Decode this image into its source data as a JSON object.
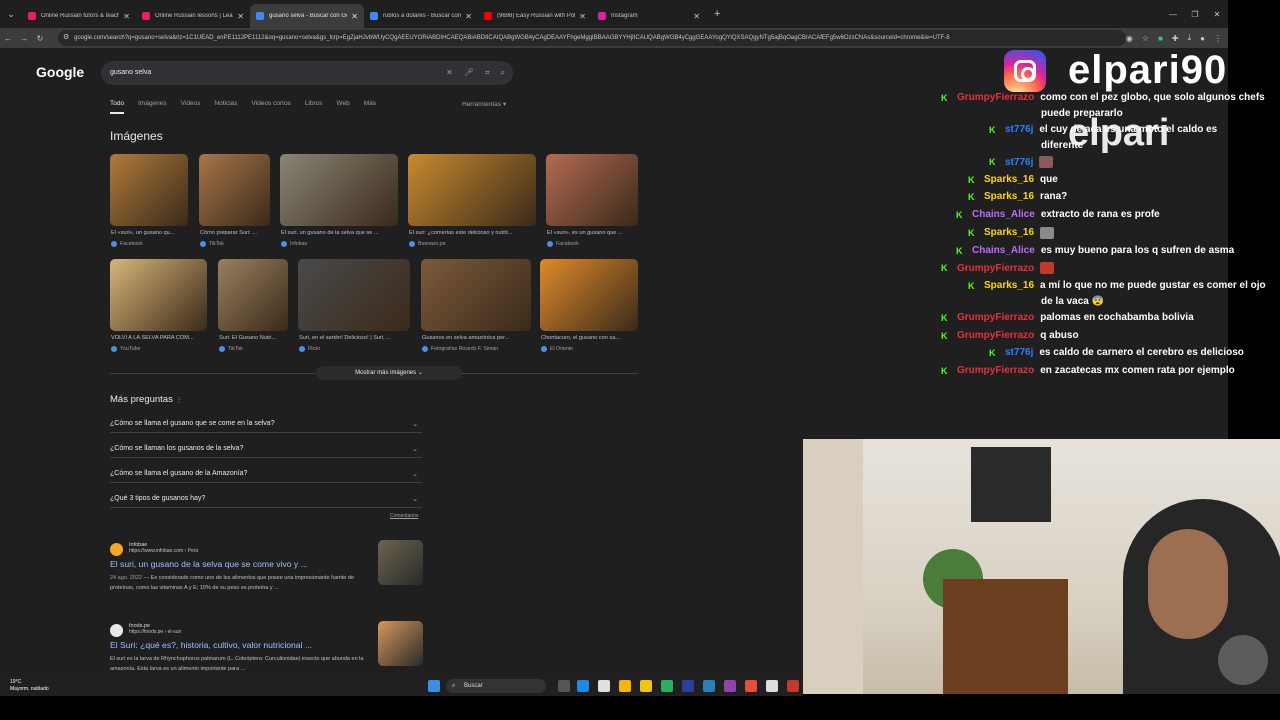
{
  "browser": {
    "tabs": [
      {
        "title": "Online Russian tutors & teache",
        "color": "#e91e63",
        "active": false
      },
      {
        "title": "Online Russian lessons | Learn",
        "color": "#e91e63",
        "active": false
      },
      {
        "title": "gusano selva - Buscar con Goo",
        "color": "#4285f4",
        "active": true
      },
      {
        "title": "rublos a dolares - Buscar con G",
        "color": "#4285f4",
        "active": false
      },
      {
        "title": "(9698) Easy Russian with Polina",
        "color": "#ff0000",
        "active": false
      },
      {
        "title": "Instagram",
        "color": "#d6249f",
        "active": false
      }
    ],
    "url": "google.com/search?q=gusano+selva&rlz=1C1UEAD_enPE1112PE1112&oq=gusano+selva&gs_lcrp=EgZjaHJvbWUyCQgAEEUYORiABDIHCAEQABiABDIICAIQABgWGB4yCAgDEAAYFhgeMggIBBAAGBYYHjIICAUQABgWGB4yCggGEAAYogQYiQXSAQgyNTg5ajBqOagCBrACAfEFg5w6OzsCNAs&sourceid=chrome&ie=UTF-8"
  },
  "google": {
    "logo": "Google",
    "query": "gusano selva",
    "filters": [
      "Todo",
      "Imágenes",
      "Videos",
      "Noticias",
      "Videos cortos",
      "Libros",
      "Web",
      "Más"
    ],
    "tools": "Herramientas",
    "images_title": "Imágenes",
    "images_row1": [
      {
        "caption": "El «suri», un gusano qu...",
        "source": "Facebook",
        "color": "#b07a3b"
      },
      {
        "caption": "Cómo preparar Suri: ...",
        "source": "TikTok",
        "color": "#a8754a"
      },
      {
        "caption": "El suri, un gusano de la selva que se ...",
        "source": "Infobae",
        "color": "#8a8575"
      },
      {
        "caption": "El suri: ¿comerías este delicioso y nutrit...",
        "source": "Buenazo.pe",
        "color": "#c98a2e"
      },
      {
        "caption": "El «suri», es un gusano que ...",
        "source": "Facebook",
        "color": "#b56a52"
      }
    ],
    "images_row2": [
      {
        "caption": "VOLVÍ A LA SELVA PARA COM...",
        "source": "YouTube",
        "color": "#d8b57a"
      },
      {
        "caption": "Suri: El Gusano Nutri...",
        "source": "TikTok",
        "color": "#9a8060"
      },
      {
        "caption": "Suri, en el sartén! Delicioso! | Suri, ...",
        "source": "Flickr",
        "color": "#4a4a4a"
      },
      {
        "caption": "Gusanos en selva amazónica per...",
        "source": "Fotografías Ricardo F. Simán",
        "color": "#7b5a3a"
      },
      {
        "caption": "Chontacuro, el gusano con sa...",
        "source": "El Oriente",
        "color": "#e08a2a"
      }
    ],
    "more_button": "Mostrar más imágenes",
    "paa_title": "Más preguntas",
    "questions": [
      "¿Cómo se llama el gusano que se come en la selva?",
      "¿Cómo se llaman los gusanos de la selva?",
      "¿Cómo se llama el gusano de la Amazonía?",
      "¿Qué 3 tipos de gusanos hay?"
    ],
    "comments_link": "Comentarios",
    "results": [
      {
        "site": "Infobae",
        "url": "https://www.infobae.com › Perú",
        "title": "El suri, un gusano de la selva que se come vivo y ...",
        "date": "24 ago. 2022 —",
        "snippet": "Es considerado como uno de los alimentos que posee una impresionante fuente de proteínas, como las vitaminas A y E; 10% de su peso es proteína y ...",
        "favicon_color": "#f5a623",
        "thumb_color": "#6b6450"
      },
      {
        "site": "foods.pe",
        "url": "https://foods.pe › el-suri",
        "title": "El Suri: ¿qué es?, historia, cultivo, valor nutricional ...",
        "date": "",
        "snippet": "El suri es la larva de Rhynchophorus palmarum (L. Coleóptera: Curculionidae) insecto que abunda en la amazonía. Esta larva es un alimento importante para ...",
        "favicon_color": "#e8e8e8",
        "thumb_color": "#d9955a"
      }
    ]
  },
  "taskbar": {
    "temp": "19°C",
    "condition": "Mayorm. nublado",
    "search": "Buscar"
  },
  "overlay": {
    "handle": "elpari90",
    "handle_shadow": "elpari",
    "chat": [
      {
        "user": "GrumpyFierrazo",
        "color": "#e7303f",
        "msg": "como con el pez globo, que solo algunos chefs",
        "indent": 0
      },
      {
        "user": "",
        "color": "#fff",
        "msg": "puede prepararlo",
        "indent": 0,
        "continuation": true
      },
      {
        "user": "st776j",
        "color": "#2f7fff",
        "msg": "el cuy de aca es una moto el caldo es",
        "indent": 1
      },
      {
        "user": "",
        "color": "#fff",
        "msg": "diferente",
        "indent": 1,
        "continuation": true
      },
      {
        "user": "st776j",
        "color": "#2f7fff",
        "msg": "",
        "indent": 1,
        "emote": "#8a5a5a"
      },
      {
        "user": "Sparks_16",
        "color": "#ffd600",
        "msg": "que",
        "indent": 2
      },
      {
        "user": "Sparks_16",
        "color": "#ffd600",
        "msg": "rana?",
        "indent": 2
      },
      {
        "user": "Chains_Alice",
        "color": "#c06bff",
        "msg": "extracto de rana es profe",
        "indent": 3
      },
      {
        "user": "Sparks_16",
        "color": "#ffd600",
        "msg": "",
        "indent": 2,
        "emote": "#8a8a8a"
      },
      {
        "user": "Chains_Alice",
        "color": "#c06bff",
        "msg": "es muy bueno para los q sufren de asma",
        "indent": 3
      },
      {
        "user": "GrumpyFierrazo",
        "color": "#e7303f",
        "msg": "",
        "indent": 0,
        "emote": "#c0392b"
      },
      {
        "user": "Sparks_16",
        "color": "#ffd600",
        "msg": "a mí lo que no me puede gustar es comer el ojo",
        "indent": 2
      },
      {
        "user": "",
        "color": "#fff",
        "msg": "de la vaca 😨",
        "indent": 2,
        "continuation": true
      },
      {
        "user": "GrumpyFierrazo",
        "color": "#e7303f",
        "msg": "palomas en cochabamba bolivia",
        "indent": 0
      },
      {
        "user": "GrumpyFierrazo",
        "color": "#e7303f",
        "msg": "q abuso",
        "indent": 0
      },
      {
        "user": "st776j",
        "color": "#2f7fff",
        "msg": "es caldo de carnero el cerebro es delicioso",
        "indent": 1
      },
      {
        "user": "GrumpyFierrazo",
        "color": "#e7303f",
        "msg": "en zacatecas mx comen rata por ejemplo",
        "indent": 0
      }
    ]
  }
}
